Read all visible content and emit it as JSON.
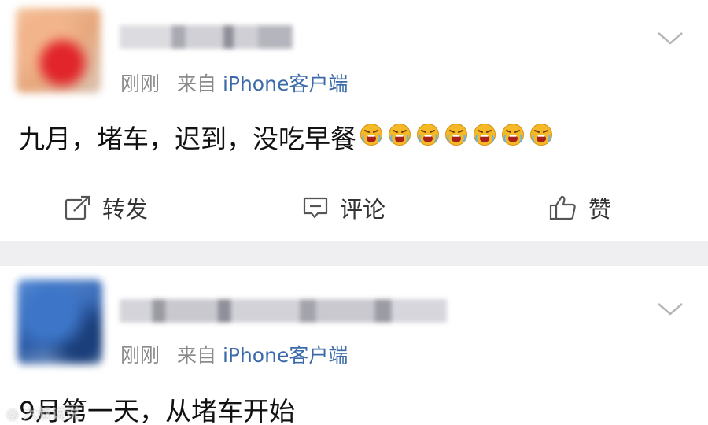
{
  "posts": [
    {
      "timestamp": "刚刚",
      "source_prefix": "来自",
      "source": "iPhone客户端",
      "text": "九月，堵车，迟到，没吃早餐",
      "emoji_name": "crying-face-emoji",
      "emoji_count": 7
    },
    {
      "timestamp": "刚刚",
      "source_prefix": "来自",
      "source": "iPhone客户端",
      "text": "9月第一天，从堵车开始"
    }
  ],
  "actions": {
    "repost_label": "转发",
    "comment_label": "评论",
    "like_label": "赞"
  },
  "icons": {
    "repost": "share-icon",
    "comment": "comment-icon",
    "like": "thumbs-up-icon",
    "menu": "chevron-down-icon"
  },
  "colors": {
    "source_link": "#3b6aa8",
    "separator": "#efeff1",
    "emoji": "#f5b928"
  }
}
